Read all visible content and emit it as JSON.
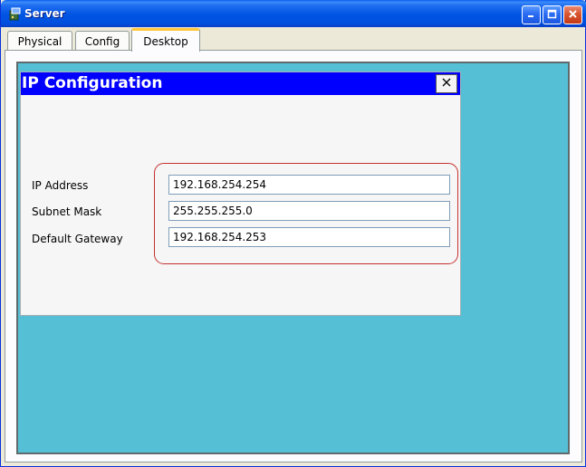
{
  "window": {
    "title": "Server",
    "icon": "server-app-icon",
    "controls": {
      "minimize": "minimize-icon",
      "maximize": "maximize-icon",
      "close": "close-icon"
    }
  },
  "tabs": [
    {
      "label": "Physical",
      "active": false
    },
    {
      "label": "Config",
      "active": false
    },
    {
      "label": "Desktop",
      "active": true
    }
  ],
  "ip_configuration": {
    "title": "IP Configuration",
    "close_label": "X",
    "fields": {
      "ip_address": {
        "label": "IP Address",
        "value": "192.168.254.254"
      },
      "subnet_mask": {
        "label": "Subnet Mask",
        "value": "255.255.255.0"
      },
      "default_gateway": {
        "label": "Default Gateway",
        "value": "192.168.254.253"
      }
    }
  },
  "colors": {
    "titlebar": "#0054e3",
    "desktop_background": "#55bfd5",
    "panel_header": "#0000ff",
    "highlight_border": "#c53030",
    "active_tab_accent": "#ffc73c"
  }
}
